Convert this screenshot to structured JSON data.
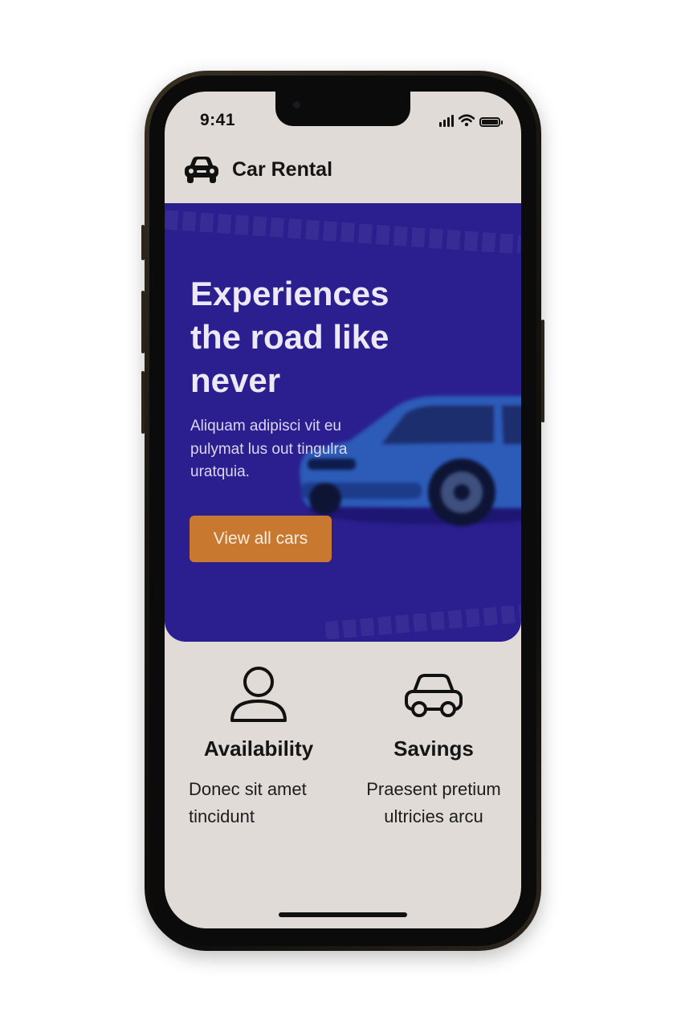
{
  "status_bar": {
    "time": "9:41",
    "icons": [
      "signal-icon",
      "wifi-icon",
      "battery-icon"
    ]
  },
  "header": {
    "logo_icon": "car-front-icon",
    "title": "Car Rental"
  },
  "hero": {
    "title": "Experiences the road like never",
    "description": "Aliquam adipisci vit eu pulymat lus out tingulra uratquia.",
    "button_label": "View all cars",
    "image": "blue-suv-car"
  },
  "features": [
    {
      "icon": "user-icon",
      "title": "Availability",
      "description": "Donec sit amet tincidunt"
    },
    {
      "icon": "car-icon",
      "title": "Savings",
      "description": "Praesent pretium ultricies arcu"
    }
  ],
  "colors": {
    "screen_background": "#e0dbd7",
    "hero_background": "#2b1f8f",
    "hero_text": "#ece8f6",
    "button": "#c8782f",
    "button_text": "#fbeee0",
    "text_dark": "#151515"
  }
}
